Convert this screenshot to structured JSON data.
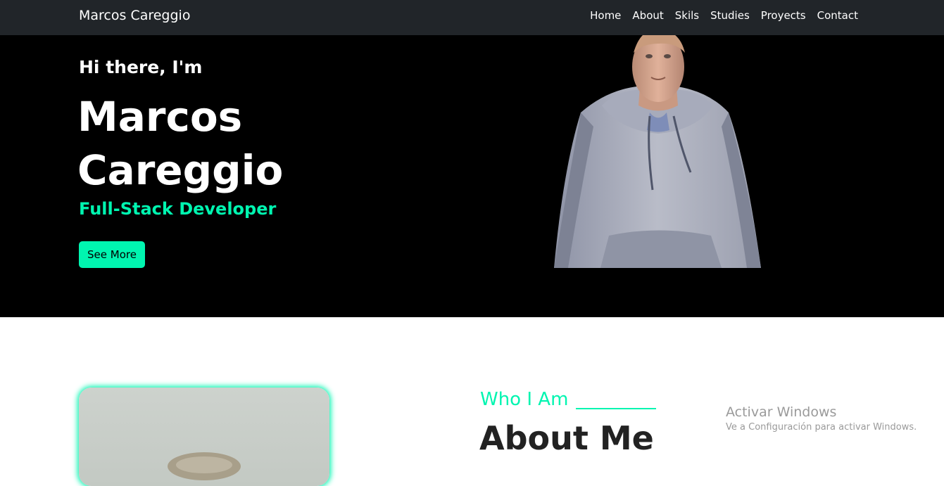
{
  "navbar": {
    "brand": "Marcos Careggio",
    "links": [
      "Home",
      "About",
      "Skils",
      "Studies",
      "Proyects",
      "Contact"
    ]
  },
  "hero": {
    "greeting": "Hi there, I'm",
    "name_line1": "Marcos",
    "name_line2": "Careggio",
    "role": "Full-Stack Developer",
    "button_label": "See More"
  },
  "about": {
    "kicker": "Who I Am",
    "title": "About Me"
  },
  "watermark": {
    "title": "Activar Windows",
    "subtitle": "Ve a Configuración para activar Windows."
  },
  "colors": {
    "accent": "#00f5b0",
    "navbar_bg": "#212529",
    "hero_bg": "#000000"
  },
  "icons": {
    "hero_image": "avatar-3d-hoodie",
    "about_image": "profile-photo"
  }
}
